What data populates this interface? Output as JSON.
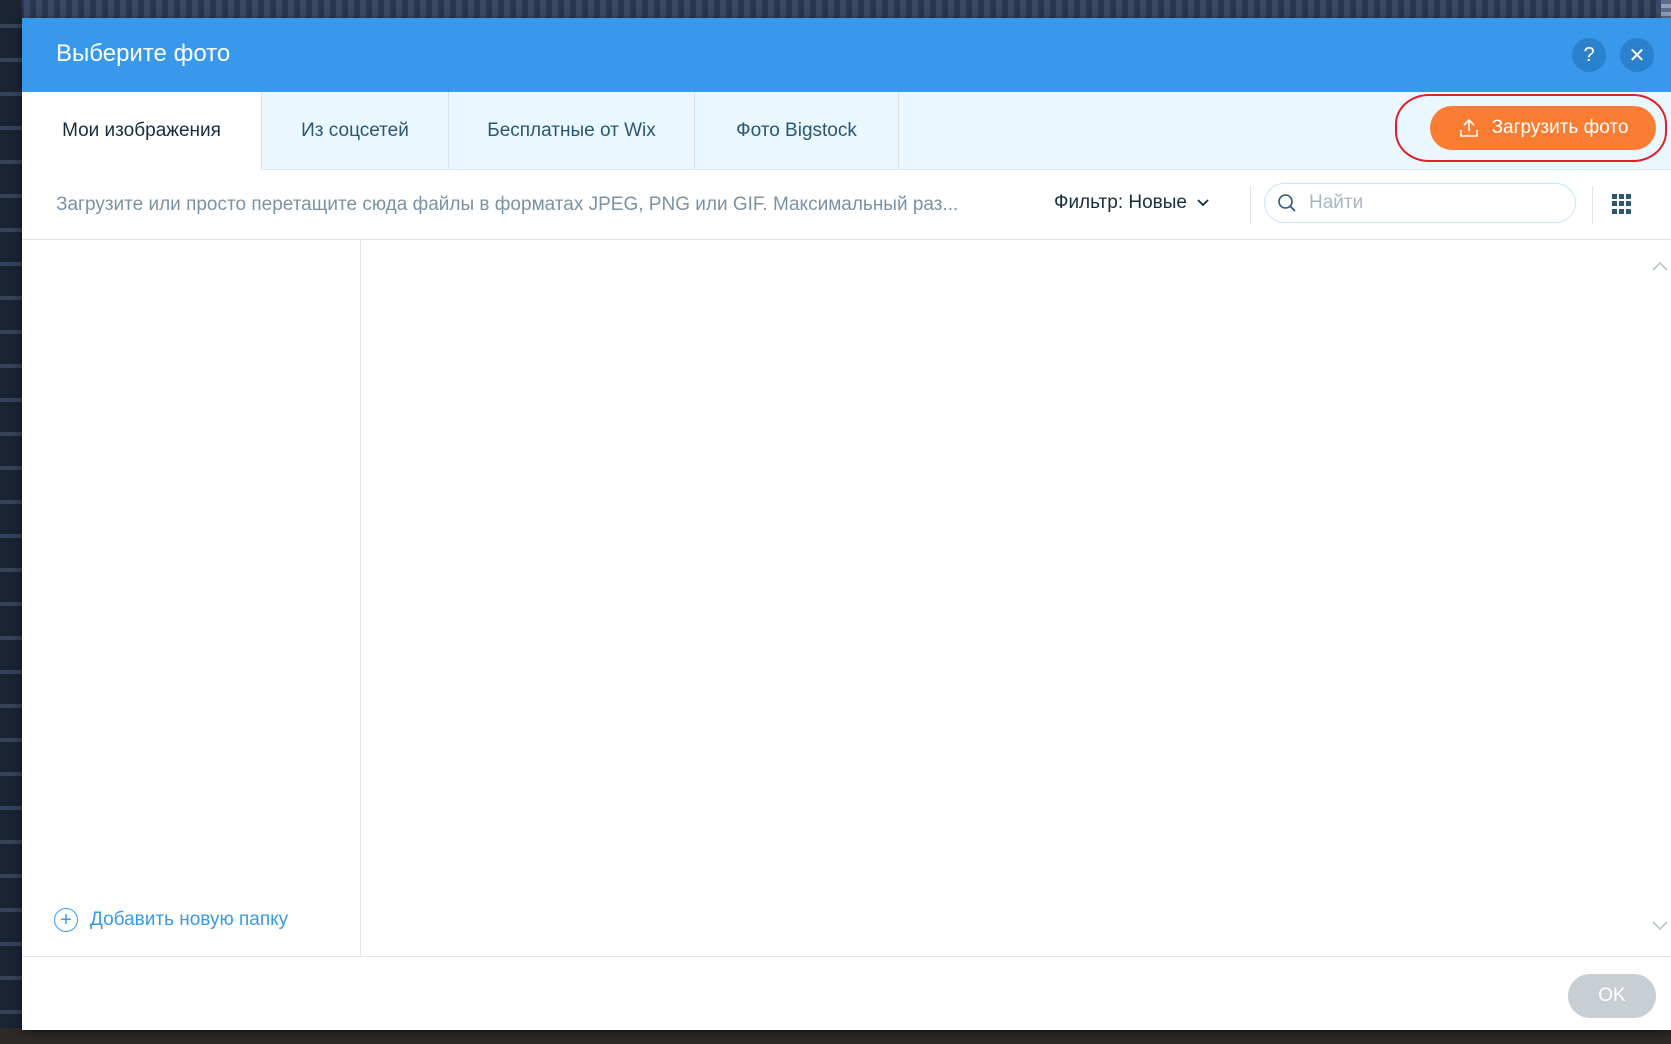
{
  "dialog": {
    "title": "Выберите фото",
    "help_label": "?",
    "close_label": "✕"
  },
  "tabs": [
    {
      "label": "Мои изображения",
      "active": true
    },
    {
      "label": "Из соцсетей",
      "active": false
    },
    {
      "label": "Бесплатные от Wix",
      "active": false
    },
    {
      "label": "Фото Bigstock",
      "active": false
    }
  ],
  "upload": {
    "label": "Загрузить фото",
    "color": "#fb7d33",
    "highlight_color": "#e0202a"
  },
  "toolbar": {
    "hint": "Загрузите или просто перетащите сюда файлы в форматах JPEG, PNG или GIF. Максимальный раз...",
    "filter_label": "Фильтр: Новые",
    "search_placeholder": "Найти"
  },
  "sidebar": {
    "add_folder_label": "Добавить новую папку"
  },
  "footer": {
    "ok_label": "OK"
  },
  "colors": {
    "header": "#3899ec",
    "tabs_bg": "#eaf7ff",
    "accent": "#3899ec"
  }
}
